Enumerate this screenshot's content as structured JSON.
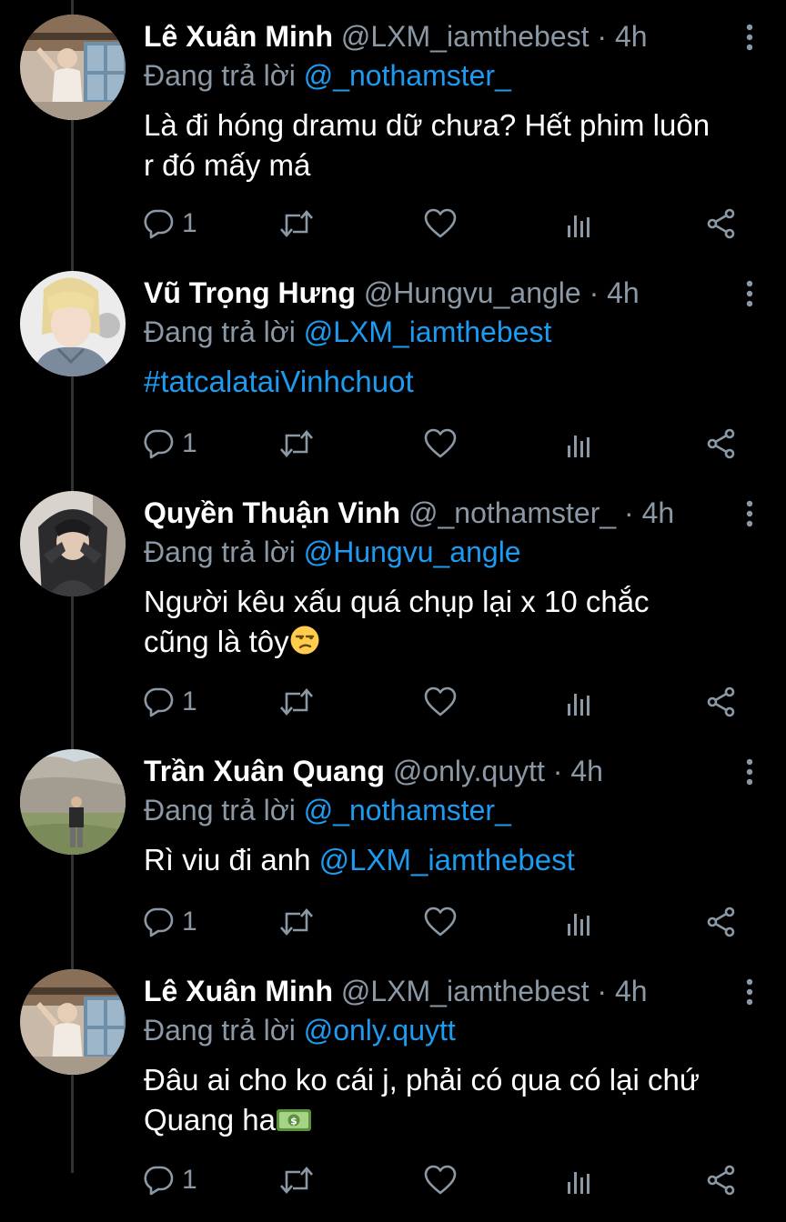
{
  "reply_prefix": "Đang trả lời",
  "colors": {
    "background": "#000000",
    "text_primary": "#ffffff",
    "text_secondary": "#8b98a5",
    "link": "#1d9bf0",
    "thread_line": "#2f3336"
  },
  "icons": {
    "reply": "reply-icon",
    "retweet": "retweet-icon",
    "like": "heart-icon",
    "analytics": "analytics-icon",
    "share": "share-icon",
    "more": "more-vertical-icon"
  },
  "tweets": [
    {
      "name": "Lê Xuân Minh",
      "handle": "@LXM_iamthebest",
      "dot": "·",
      "time": "4h",
      "reply_to": "@_nothamster_",
      "text_line1": "Là đi hóng dramu dữ chưa? Hết phim luôn",
      "text_line2": "r đó mấy má",
      "reply_count": "1"
    },
    {
      "name": "Vũ Trọng Hưng",
      "handle": "@Hungvu_angle",
      "dot": "·",
      "time": "4h",
      "reply_to": "@LXM_iamthebest",
      "hashtag": "#tatcalataiVinhchuot",
      "reply_count": "1"
    },
    {
      "name": "Quyền Thuận Vinh",
      "handle": "@_nothamster_",
      "dot": "·",
      "time": "4h",
      "reply_to": "@Hungvu_angle",
      "text_line1": "Người kêu xấu quá chụp lại x 10 chắc",
      "text_line2": "cũng là tôy",
      "emoji": "unamused-face-emoji",
      "reply_count": "1"
    },
    {
      "name": "Trần Xuân Quang",
      "handle": "@only.quytt",
      "dot": "·",
      "time": "4h",
      "reply_to": "@_nothamster_",
      "text_prefix": "Rì viu đi anh",
      "text_mention": "@LXM_iamthebest",
      "reply_count": "1"
    },
    {
      "name": "Lê Xuân Minh",
      "handle": "@LXM_iamthebest",
      "dot": "·",
      "time": "4h",
      "reply_to": "@only.quytt",
      "text_line1": "Đâu ai cho ko cái j, phải có qua có lại chứ",
      "text_line2": "Quang ha",
      "emoji": "dollar-banknote-emoji",
      "reply_count": "1"
    }
  ]
}
